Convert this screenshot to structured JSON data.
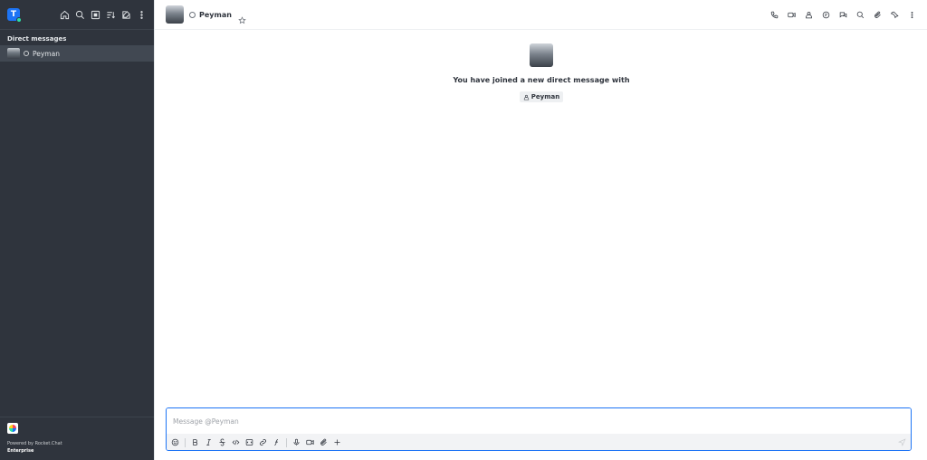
{
  "sidebar": {
    "workspace_initial": "T",
    "section_title": "Direct messages",
    "items": [
      {
        "label": "Peyman"
      }
    ],
    "powered_by": "Powered by Rocket.Chat",
    "edition": "Enterprise"
  },
  "header": {
    "room_name": "Peyman"
  },
  "welcome": {
    "message": "You have joined a new direct message with",
    "user": "Peyman"
  },
  "composer": {
    "placeholder": "Message @Peyman"
  },
  "colors": {
    "sidebar_bg": "#2f343d",
    "accent": "#1d74f5",
    "text": "#2f343d"
  }
}
